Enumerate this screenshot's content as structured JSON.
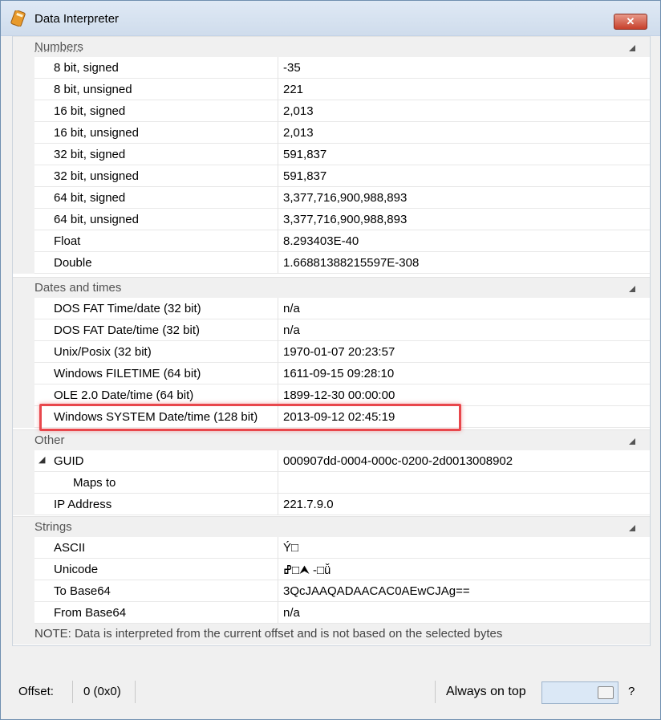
{
  "window": {
    "title": "Data Interpreter",
    "close_glyph": "✕"
  },
  "sections": {
    "numbers": {
      "title": "Numbers",
      "rows": [
        {
          "name": "8 bit, signed",
          "value": "-35"
        },
        {
          "name": "8 bit, unsigned",
          "value": "221"
        },
        {
          "name": "16 bit, signed",
          "value": "2,013"
        },
        {
          "name": "16 bit, unsigned",
          "value": "2,013"
        },
        {
          "name": "32 bit, signed",
          "value": "591,837"
        },
        {
          "name": "32 bit, unsigned",
          "value": "591,837"
        },
        {
          "name": "64 bit, signed",
          "value": "3,377,716,900,988,893"
        },
        {
          "name": "64 bit, unsigned",
          "value": "3,377,716,900,988,893"
        },
        {
          "name": "Float",
          "value": "8.293403E-40"
        },
        {
          "name": "Double",
          "value": "1.66881388215597E-308"
        }
      ]
    },
    "dates": {
      "title": "Dates and times",
      "rows": [
        {
          "name": "DOS FAT Time/date (32 bit)",
          "value": "n/a"
        },
        {
          "name": "DOS FAT Date/time (32 bit)",
          "value": "n/a"
        },
        {
          "name": "Unix/Posix (32 bit)",
          "value": "1970-01-07 20:23:57"
        },
        {
          "name": "Windows FILETIME (64 bit)",
          "value": "1611-09-15 09:28:10"
        },
        {
          "name": "OLE 2.0 Date/time (64 bit)",
          "value": "1899-12-30 00:00:00"
        },
        {
          "name": "Windows SYSTEM Date/time (128 bit)",
          "value": "2013-09-12 02:45:19"
        }
      ]
    },
    "other": {
      "title": "Other",
      "rows": [
        {
          "name": "GUID",
          "value": "000907dd-0004-000c-0200-2d0013008902"
        },
        {
          "name": "Maps to",
          "value": ""
        },
        {
          "name": "IP Address",
          "value": "221.7.9.0"
        }
      ]
    },
    "strings": {
      "title": "Strings",
      "rows": [
        {
          "name": "ASCII",
          "value": "Ý□"
        },
        {
          "name": "Unicode",
          "value": "ߝ□⮝ -□ǚ"
        },
        {
          "name": "To Base64",
          "value": "3QcJAAQADAACAC0AEwCJAg=="
        },
        {
          "name": "From Base64",
          "value": "n/a"
        }
      ]
    }
  },
  "guid_expander": "◢",
  "note": "NOTE: Data is interpreted from the current offset and is not based on the selected bytes",
  "status": {
    "offset_label": "Offset:",
    "offset_value": "0 (0x0)",
    "always_on_top": "Always on top",
    "help": "?"
  },
  "colors": {
    "highlight": "#e8474c",
    "title_bar": "#dfe9f5",
    "toggle": "#dbe8f6"
  }
}
